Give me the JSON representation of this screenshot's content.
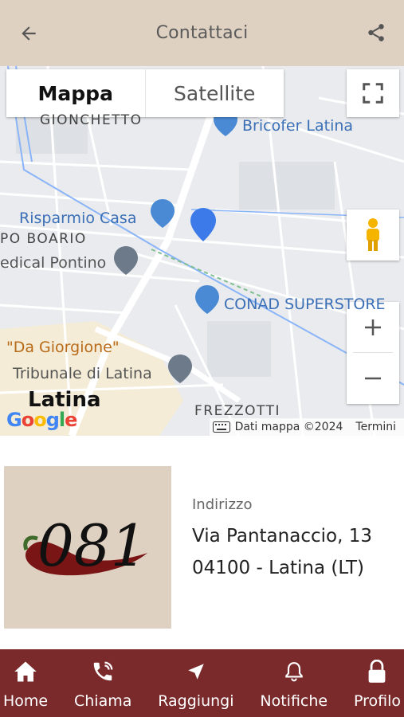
{
  "header": {
    "title": "Contattaci",
    "back_icon": "arrow-left-icon",
    "share_icon": "share-icon"
  },
  "map": {
    "map_type_options": [
      "Mappa",
      "Satellite"
    ],
    "selected_map_type": "Mappa",
    "labels": {
      "gionchetto": "GIONCHETTO",
      "bricofer": "Bricofer Latina",
      "risparmio": "Risparmio Casa",
      "boario": "PO BOARIO",
      "pontino": "edical Pontino",
      "conad": "CONAD SUPERSTORE",
      "giorgione": "\"Da Giorgione\"",
      "tribunale": "Tribunale di Latina",
      "latina": "Latina",
      "frezzotti": "FREZZOTTI"
    },
    "google": "Google",
    "attribution": "Dati mappa ©2024",
    "terms": "Termini",
    "zoom_in": "+",
    "zoom_out": "−"
  },
  "info": {
    "logo_text": "081",
    "address_label": "Indirizzo",
    "address_line1": "Via Pantanaccio, 13",
    "address_line2": "04100 - Latina (LT)"
  },
  "nav": {
    "items": [
      {
        "label": "Home",
        "icon": "home-icon"
      },
      {
        "label": "Chiama",
        "icon": "phone-icon"
      },
      {
        "label": "Raggiungi",
        "icon": "navigation-arrow-icon"
      },
      {
        "label": "Notifiche",
        "icon": "bell-icon"
      },
      {
        "label": "Profilo",
        "icon": "lock-icon"
      }
    ]
  },
  "colors": {
    "header_bg": "#dfd1c2",
    "nav_bg": "#7a2a2b",
    "poi_blue": "#3b6fb6"
  }
}
